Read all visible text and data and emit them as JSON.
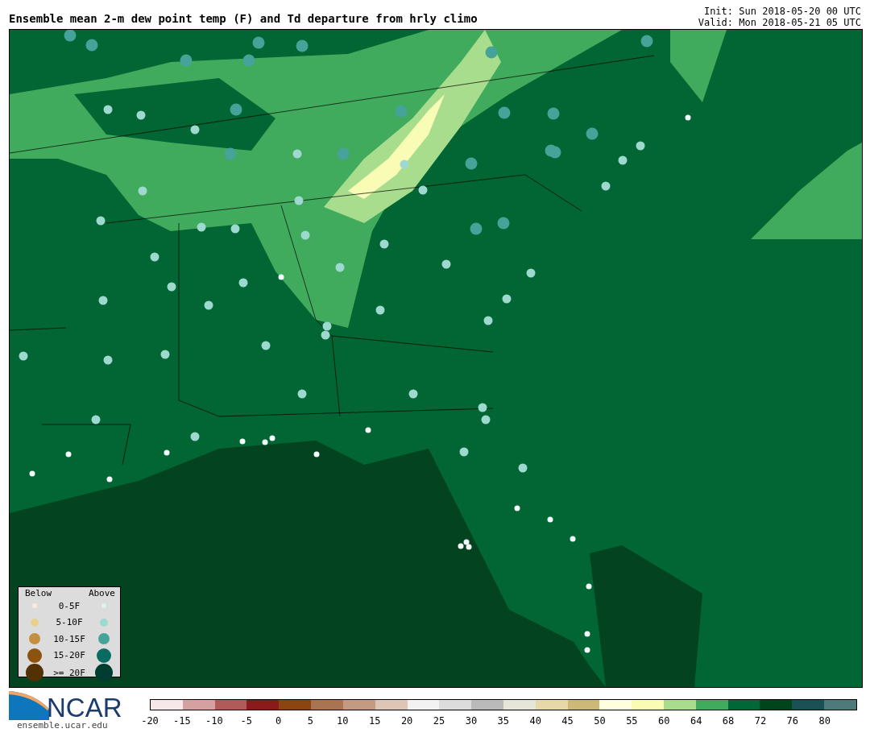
{
  "title": "Ensemble mean 2-m dew point temp (F) and Td departure from hrly climo",
  "init": "Init: Sun 2018-05-20 00 UTC",
  "valid": "Valid: Mon 2018-05-21 05 UTC",
  "legend": {
    "below_heading": "Below",
    "above_heading": "Above",
    "rows": [
      {
        "label": "0-5F",
        "below": {
          "color": "#f8ecd8"
        },
        "above": {
          "color": "#dff2f0"
        }
      },
      {
        "label": "5-10F",
        "below": {
          "color": "#e8d090"
        },
        "above": {
          "color": "#9ed9d0"
        }
      },
      {
        "label": "10-15F",
        "below": {
          "color": "#c58e40"
        },
        "above": {
          "color": "#45a39a"
        }
      },
      {
        "label": "15-20F",
        "below": {
          "color": "#8c5210"
        },
        "above": {
          "color": "#0a6b63"
        }
      },
      {
        "label": ">= 20F",
        "below": {
          "color": "#543005"
        },
        "above": {
          "color": "#003c30"
        }
      }
    ]
  },
  "logo": {
    "text": "NCAR",
    "url": "ensemble.ucar.edu"
  },
  "colorbar": {
    "segments": [
      {
        "color": "#f6e8e8"
      },
      {
        "color": "#d4a0a0"
      },
      {
        "color": "#b05a5a"
      },
      {
        "color": "#8b1a1a"
      },
      {
        "color": "#8b4513"
      },
      {
        "color": "#a87452"
      },
      {
        "color": "#c49a80"
      },
      {
        "color": "#dfc5b5"
      },
      {
        "color": "#f2f2f2"
      },
      {
        "color": "#dcdcdc"
      },
      {
        "color": "#bababa"
      },
      {
        "color": "#e6e6d8"
      },
      {
        "color": "#e6d8a8"
      },
      {
        "color": "#cdb87a"
      },
      {
        "color": "#ffffe0"
      },
      {
        "color": "#f8fcb4"
      },
      {
        "color": "#a9dd8e"
      },
      {
        "color": "#41ab5d"
      },
      {
        "color": "#006837"
      },
      {
        "color": "#00441b"
      },
      {
        "color": "#1b5154"
      },
      {
        "color": "#4d7b7b"
      }
    ],
    "ticks": [
      "-20",
      "-15",
      "-10",
      "-5",
      "0",
      "5",
      "10",
      "15",
      "20",
      "25",
      "30",
      "35",
      "40",
      "45",
      "50",
      "55",
      "60",
      "64",
      "68",
      "72",
      "76",
      "80"
    ]
  }
}
